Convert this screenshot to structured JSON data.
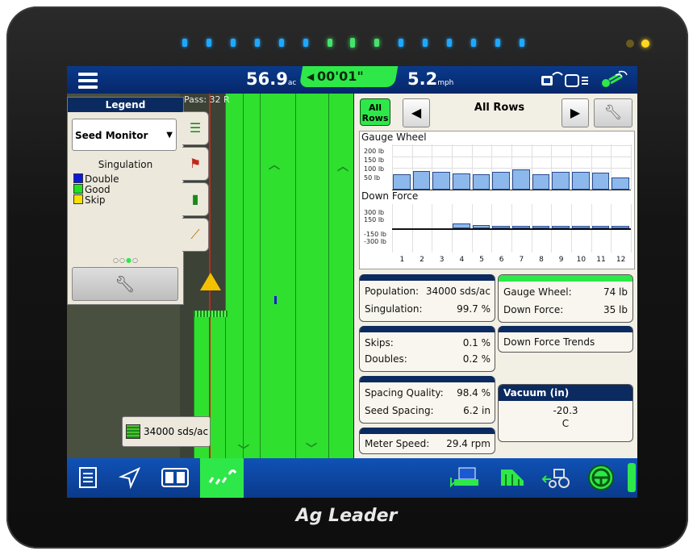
{
  "top_bar": {
    "menu_icon": "hamburger-menu-icon",
    "area_value": "56.9",
    "area_unit": "ac",
    "timer": "00'01\"",
    "speed_value": "5.2",
    "speed_unit": "mph"
  },
  "map": {
    "pass_label": "Pass: 32 R"
  },
  "legend": {
    "title": "Legend",
    "selected_layer": "Seed Monitor",
    "subtitle": "Singulation",
    "items": [
      {
        "label": "Double",
        "color": "#0b1ad8"
      },
      {
        "label": "Good",
        "color": "#22e022"
      },
      {
        "label": "Skip",
        "color": "#f8e000"
      }
    ]
  },
  "population_card": {
    "value": "34000 sds/ac"
  },
  "rows_control": {
    "all_rows_label": "All\nRows",
    "title": "All Rows"
  },
  "charts": {
    "gauge_title": "Gauge Wheel",
    "gauge_ticks": [
      "200 lb",
      "150 lb",
      "100 lb",
      "50 lb"
    ],
    "downforce_title": "Down Force",
    "downforce_ticks": [
      "300 lb",
      "150 lb",
      "-150 lb",
      "-300 lb"
    ],
    "rows": [
      "1",
      "2",
      "3",
      "4",
      "5",
      "6",
      "7",
      "8",
      "9",
      "10",
      "11",
      "12"
    ]
  },
  "chart_data": [
    {
      "type": "bar",
      "title": "Gauge Wheel",
      "categories": [
        "1",
        "2",
        "3",
        "4",
        "5",
        "6",
        "7",
        "8",
        "9",
        "10",
        "11",
        "12"
      ],
      "values": [
        70,
        84,
        82,
        72,
        70,
        80,
        92,
        68,
        82,
        80,
        76,
        56
      ],
      "ylim": [
        0,
        220
      ],
      "ylabel_ticks": [
        "50 lb",
        "100 lb",
        "150 lb",
        "200 lb"
      ]
    },
    {
      "type": "bar",
      "title": "Down Force",
      "categories": [
        "1",
        "2",
        "3",
        "4",
        "5",
        "6",
        "7",
        "8",
        "9",
        "10",
        "11",
        "12"
      ],
      "values": [
        0,
        0,
        0,
        60,
        40,
        35,
        30,
        30,
        30,
        30,
        30,
        30
      ],
      "ylim": [
        -300,
        300
      ],
      "ylabel_ticks": [
        "300 lb",
        "150 lb",
        "-150 lb",
        "-300 lb"
      ]
    }
  ],
  "cards": {
    "population_label": "Population:",
    "population_value": "34000 sds/ac",
    "singulation_label": "Singulation:",
    "singulation_value": "99.7 %",
    "gauge_wheel_label": "Gauge Wheel:",
    "gauge_wheel_value": "74 lb",
    "down_force_label": "Down Force:",
    "down_force_value": "35 lb",
    "skips_label": "Skips:",
    "skips_value": "0.1 %",
    "doubles_label": "Doubles:",
    "doubles_value": "0.2 %",
    "down_force_trends": "Down Force Trends",
    "vacuum_title": "Vacuum (in)",
    "vacuum_value": "-20.3",
    "vacuum_section": "C",
    "spacing_quality_label": "Spacing Quality:",
    "spacing_quality_value": "98.4 %",
    "seed_spacing_label": "Seed Spacing:",
    "seed_spacing_value": "6.2 in",
    "meter_speed_label": "Meter Speed:",
    "meter_speed_value": "29.4 rpm"
  },
  "brand": "Ag Leader",
  "colors": {
    "accent_green": "#2ee84a",
    "bar_blue": "#0a3a8c"
  }
}
